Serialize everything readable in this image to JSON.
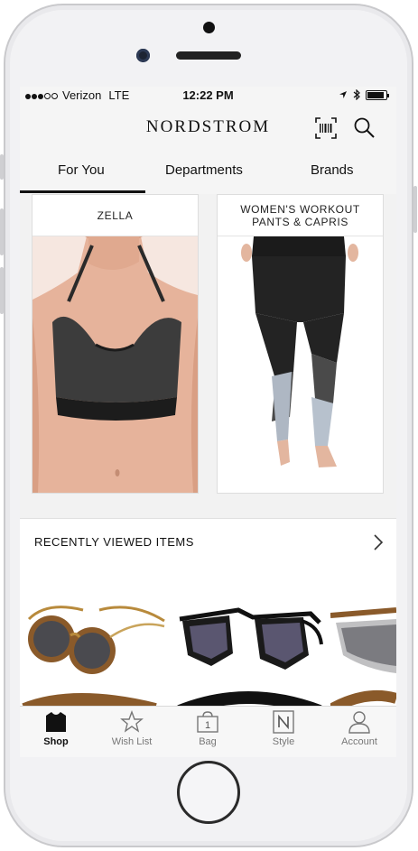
{
  "status_bar": {
    "carrier": "Verizon",
    "network": "LTE",
    "time": "12:22 PM"
  },
  "header": {
    "logo": "NORDSTROM",
    "icons": [
      "barcode-scanner-icon",
      "search-icon"
    ]
  },
  "tabs": [
    {
      "label": "For You",
      "active": true
    },
    {
      "label": "Departments",
      "active": false
    },
    {
      "label": "Brands",
      "active": false
    }
  ],
  "cards": [
    {
      "title": "ZELLA"
    },
    {
      "title": "WOMEN'S WORKOUT PANTS & CAPRIS"
    }
  ],
  "recently_viewed": {
    "title": "RECENTLY VIEWED ITEMS"
  },
  "tab_bar": [
    {
      "label": "Shop",
      "icon": "shirt-icon",
      "active": true
    },
    {
      "label": "Wish List",
      "icon": "star-icon",
      "active": false
    },
    {
      "label": "Bag",
      "icon": "bag-icon",
      "badge": "1",
      "active": false
    },
    {
      "label": "Style",
      "icon": "style-n-icon",
      "active": false
    },
    {
      "label": "Account",
      "icon": "person-icon",
      "active": false
    }
  ],
  "colors": {
    "screen_bg": "#f5f5f5",
    "text": "#111111",
    "inactive": "#777777"
  }
}
